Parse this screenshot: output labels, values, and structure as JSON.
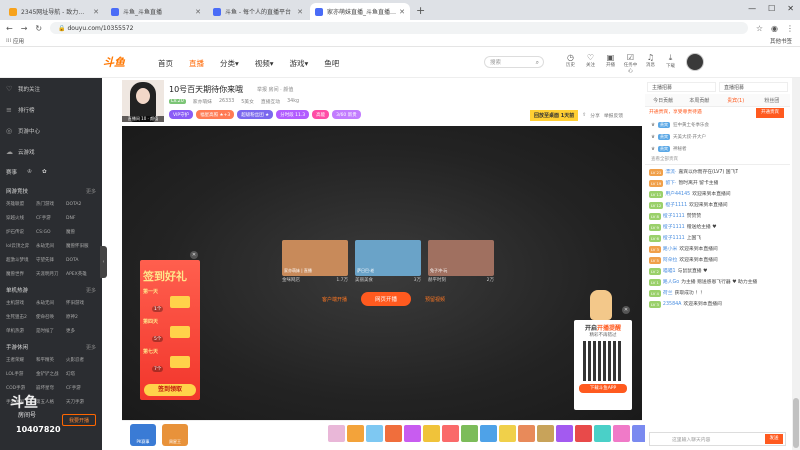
{
  "browser": {
    "tabs": [
      {
        "title": "2345网址导航 - 致力于打造百年",
        "color": "#f7a21b",
        "active": false
      },
      {
        "title": "斗鱼_斗鱼直播",
        "color": "#4a6cf7",
        "active": false
      },
      {
        "title": "斗鱼 - 每个人的直播平台",
        "color": "#4a6cf7",
        "active": false
      },
      {
        "title": "家亦萌妹直播_斗鱼直播 - 斗鱼",
        "color": "#4a6cf7",
        "active": true
      }
    ],
    "url": "douyu.com/10355572",
    "bookmarks_label": "应用",
    "other_bookmarks": "其他书签"
  },
  "header": {
    "logo": "斗鱼",
    "nav": [
      "首页",
      "直播",
      "分类▾",
      "视频▾",
      "游戏▾",
      "鱼吧"
    ],
    "search_placeholder": "搜索",
    "icons": [
      {
        "name": "history-icon",
        "glyph": "◷",
        "label": "历史"
      },
      {
        "name": "follow-icon",
        "glyph": "♡",
        "label": "关注"
      },
      {
        "name": "broadcast-icon",
        "glyph": "▣",
        "label": "开播"
      },
      {
        "name": "tasks-icon",
        "glyph": "☑",
        "label": "任务中心"
      },
      {
        "name": "notification-icon",
        "glyph": "♫",
        "label": "消息"
      },
      {
        "name": "download-icon",
        "glyph": "⤓",
        "label": "下载"
      }
    ]
  },
  "sidebar": {
    "items": [
      {
        "icon": "♡",
        "label": "我的关注"
      },
      {
        "icon": "≡",
        "label": "排行榜"
      },
      {
        "icon": "◎",
        "label": "页游中心"
      },
      {
        "icon": "☁",
        "label": "云游戏"
      }
    ],
    "shortcut_icons": [
      "赛事",
      "♔",
      "✿"
    ],
    "sections": [
      {
        "title": "网游竞技",
        "more": "更多",
        "items": [
          "英雄联盟",
          "热门游戏",
          "DOTA2",
          "穿越火线",
          "CF手游",
          "DNF",
          "炉石传说",
          "CS:GO",
          "魔兽",
          "lol云顶之弈",
          "永劫无间",
          "魔兽怀旧服",
          "超激斗梦境",
          "守望先锋",
          "DOTA",
          "魔兽世界",
          "天涯明月刀",
          "APEX英雄"
        ]
      },
      {
        "title": "单机热游",
        "more": "更多",
        "items": [
          "主机游戏",
          "永劫无间",
          "怀旧游戏",
          "生死狙击2",
          "使命召唤",
          "原神2",
          "单机热游",
          "是时候了",
          "更多"
        ]
      },
      {
        "title": "手游休闲",
        "more": "更多",
        "items": [
          "王者荣耀",
          "和平精英",
          "火影忍者",
          "LOL手游",
          "金铲铲之战",
          "幻塔",
          "COD手游",
          "崩坏星穹",
          "CF手游",
          "手游休闲",
          "第五人格",
          "天刀手游"
        ]
      }
    ],
    "bottom_logo": "斗鱼",
    "bottom_sub": "房间号",
    "room_number": "10407820",
    "bottom_button": "我要开播"
  },
  "room": {
    "title": "10号百天期待你来哦",
    "sub": "举报  房间 · 颜值",
    "avatar_tag": "直播间 10 · 颜值",
    "level": "Lv.20",
    "host": "家亦萌妹",
    "meta": [
      "26333",
      "5美女",
      "直播互动",
      "34kg"
    ],
    "badges": [
      {
        "text": "VIP守护",
        "color": "#8a5cf6"
      },
      {
        "text": "福星高照 ★+3",
        "color": "#ff7b54"
      },
      {
        "text": "超级粉丝团 ★",
        "color": "#7b68ee"
      },
      {
        "text": "分时段 11.3",
        "color": "#b25cff"
      },
      {
        "text": "高能",
        "color": "#ff4da6"
      },
      {
        "text": "3/60 新贵",
        "color": "#c27cff"
      }
    ],
    "yellow_button": "回放至桌面 1天前",
    "share": "分享",
    "report": "举报反馈"
  },
  "player": {
    "promo": {
      "title": "签到好礼",
      "days": [
        {
          "label": "第一天",
          "val": "1"
        },
        {
          "label": "第四天",
          "val": "5"
        },
        {
          "label": "第七天",
          "val": "7"
        }
      ],
      "values": [
        "1个",
        "5个",
        "7个"
      ],
      "cta": "签到领取"
    },
    "thumbs": [
      {
        "caption": "家亦萌妹 | 直播",
        "name": "金咪网店",
        "count": "1.7万",
        "color": "#c88a5a"
      },
      {
        "caption": "萨日巴·老",
        "name": "美丽美食",
        "count": "3万",
        "color": "#6aa3c8"
      },
      {
        "caption": "兔子冲·玩",
        "name": "赫平时刻",
        "count": "2万",
        "color": "#a07060"
      }
    ],
    "actions": {
      "left": "客户端开播",
      "center": "网页开播",
      "right": "预留视频"
    },
    "qr": {
      "title_a": "开启",
      "title_b": "开播提醒",
      "sub": "精彩不再错过",
      "download": "下载斗鱼APP"
    }
  },
  "giftbar": {
    "left_badges": [
      {
        "label": "PK赛事",
        "color": "#3a7bd5"
      },
      {
        "label": "周星王",
        "color": "#e8923a"
      }
    ],
    "gifts": [
      "#e9b7d8",
      "#f3a33a",
      "#7ec8f2",
      "#f06e3c",
      "#c85cf0",
      "#f0c33a",
      "#fa6a6a",
      "#7cbc5a",
      "#4ea2e8",
      "#f0d04a",
      "#e88a5a",
      "#c8a35a",
      "#a35af0",
      "#e84a4a",
      "#4ad0c8",
      "#f07ac8",
      "#7a8af0",
      "#f0a07a",
      "#5ac87a",
      "#c87af0",
      "#e8b04a",
      "#7ae0f0",
      "#f05a8a"
    ]
  },
  "right_panel": {
    "top_buttons": [
      "主播招募",
      "直播招募"
    ],
    "tabs": [
      {
        "label": "今日贡献",
        "active": false
      },
      {
        "label": "本周贡献",
        "active": false
      },
      {
        "label": "贵宾(1)",
        "active": true
      },
      {
        "label": "粉丝团",
        "active": false
      }
    ],
    "promo": "开通贵宾，享受尊贵待遇",
    "promo_button": "开通贵宾",
    "ranks": [
      {
        "lv": "贵宾",
        "name": "狂中黄土冬季乐会"
      },
      {
        "lv": "贵宾",
        "name": "天美大叔·开大户"
      },
      {
        "lv": "贵宾",
        "name": "神秘者"
      }
    ],
    "note": "查看全部贵宾",
    "messages": [
      {
        "lv": "LV 21",
        "lvc": "#f0a04a",
        "u": "漂流·",
        "t": "嘉宾以你而存在(LV7)  国飞T"
      },
      {
        "lv": "LV 19",
        "lvc": "#f0a04a",
        "u": "留下·",
        "t": "暂时离开  留卡主播"
      },
      {
        "lv": "LV 11",
        "lvc": "#9ad06a",
        "u": "用户44145",
        "t": "欢迎来到本直播间"
      },
      {
        "lv": "LV 12",
        "lvc": "#9ad06a",
        "u": "橙子1111",
        "t": "欢迎来到本直播间"
      },
      {
        "lv": "LV 8",
        "lvc": "#9ad06a",
        "u": "橙子1111",
        "t": "赞赞赞"
      },
      {
        "lv": "LV 9",
        "lvc": "#9ad06a",
        "u": "橙子1111",
        "t": "赠送给主播 ♥"
      },
      {
        "lv": "LV 6",
        "lvc": "#9ad06a",
        "u": "橙子1111",
        "t": "上国飞"
      },
      {
        "lv": "LV 3",
        "lvc": "#f0a04a",
        "u": "路小米",
        "t": "欢迎来到本直播间"
      },
      {
        "lv": "LV 5",
        "lvc": "#f0a04a",
        "u": "阿朵拉",
        "t": "欢迎来到本直播间"
      },
      {
        "lv": "LV 2",
        "lvc": "#9ad06a",
        "u": "喵喵1",
        "t": "与鼠鼠直播 ♥"
      },
      {
        "lv": "LV 1",
        "lvc": "#9ad06a",
        "u": "路人Go",
        "t": "为主播 赠送感恩飞行器 ♥ 助力主播"
      },
      {
        "lv": "LV 4",
        "lvc": "#9ad06a",
        "u": "荷兰",
        "t": "获取成功 ！！"
      },
      {
        "lv": "LV 3",
        "lvc": "#9ad06a",
        "u": "23584A",
        "t": "欢迎来到本直播间"
      }
    ],
    "input_placeholder": "这里输入聊天内容",
    "send": "发送"
  }
}
